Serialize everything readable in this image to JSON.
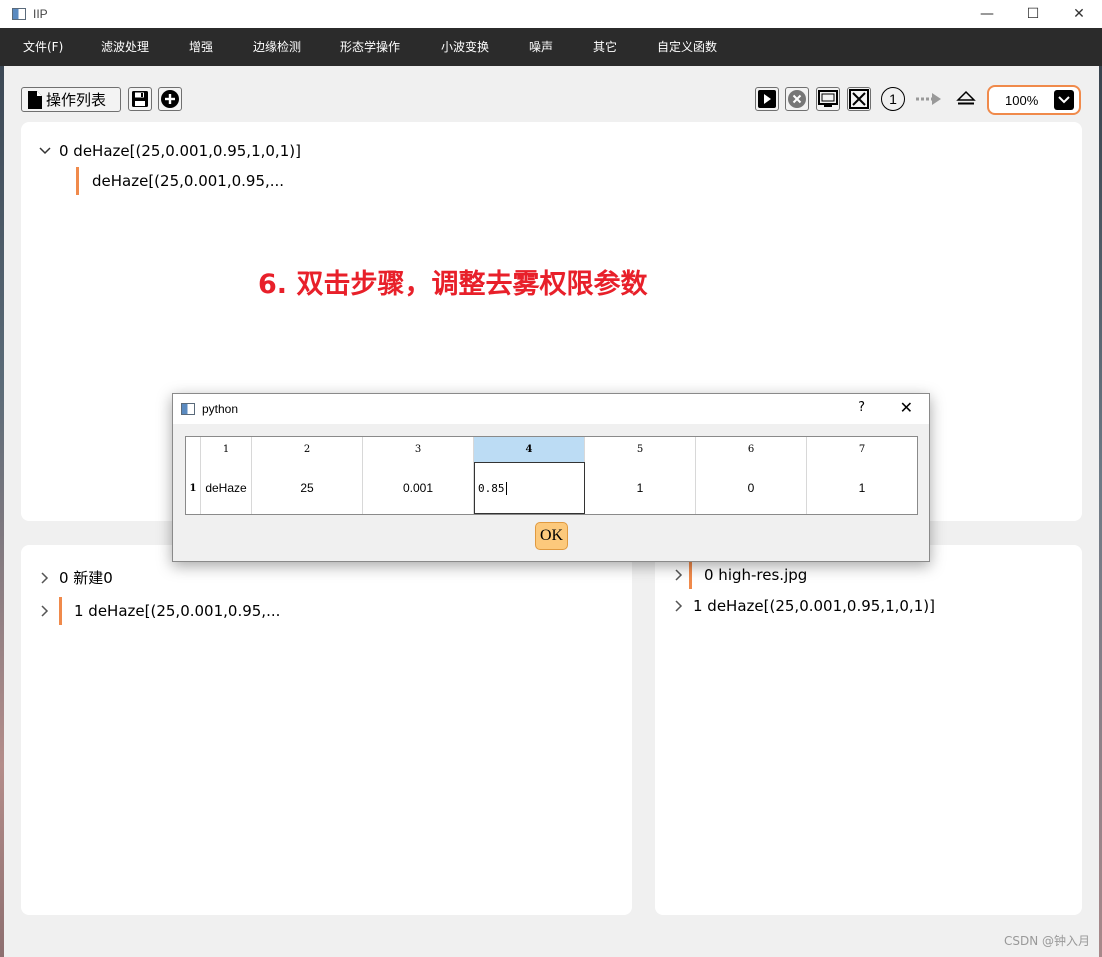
{
  "window": {
    "title": "IIP",
    "minimize": "—",
    "maximize": "☐",
    "close": "✕"
  },
  "menubar": {
    "items": [
      "文件(F)",
      "滤波处理",
      "增强",
      "边缘检测",
      "形态学操作",
      "小波变换",
      "噪声",
      "其它",
      "自定义函数"
    ]
  },
  "toolbar": {
    "ops_list_label": "操作列表",
    "zoom": "100%",
    "step_number": "1"
  },
  "top_panel": {
    "root_item": "0 deHaze[(25,0.001,0.95,1,0,1)]",
    "child_item": "deHaze[(25,0.001,0.95,..."
  },
  "annotation": "6. 双击步骤，调整去雾权限参数",
  "left_panel": {
    "items": [
      "0 新建0",
      "1 deHaze[(25,0.001,0.95,..."
    ]
  },
  "right_panel": {
    "items": [
      "0 high-res.jpg",
      "1 deHaze[(25,0.001,0.95,1,0,1)]"
    ]
  },
  "dialog": {
    "title": "python",
    "help": "?",
    "close": "✕",
    "row_header": "1",
    "columns": [
      "1",
      "2",
      "3",
      "4",
      "5",
      "6",
      "7"
    ],
    "values": [
      "deHaze",
      "25",
      "0.001",
      "0.85",
      "1",
      "0",
      "1"
    ],
    "ok_label": "OK"
  },
  "watermark": "CSDN @钟入月",
  "colors": {
    "accent": "#f08a4b",
    "annotation": "#e8202a",
    "menubar": "#2b2b2b",
    "ok_button": "#fcc97c",
    "selected_header": "#bcdcf4"
  }
}
